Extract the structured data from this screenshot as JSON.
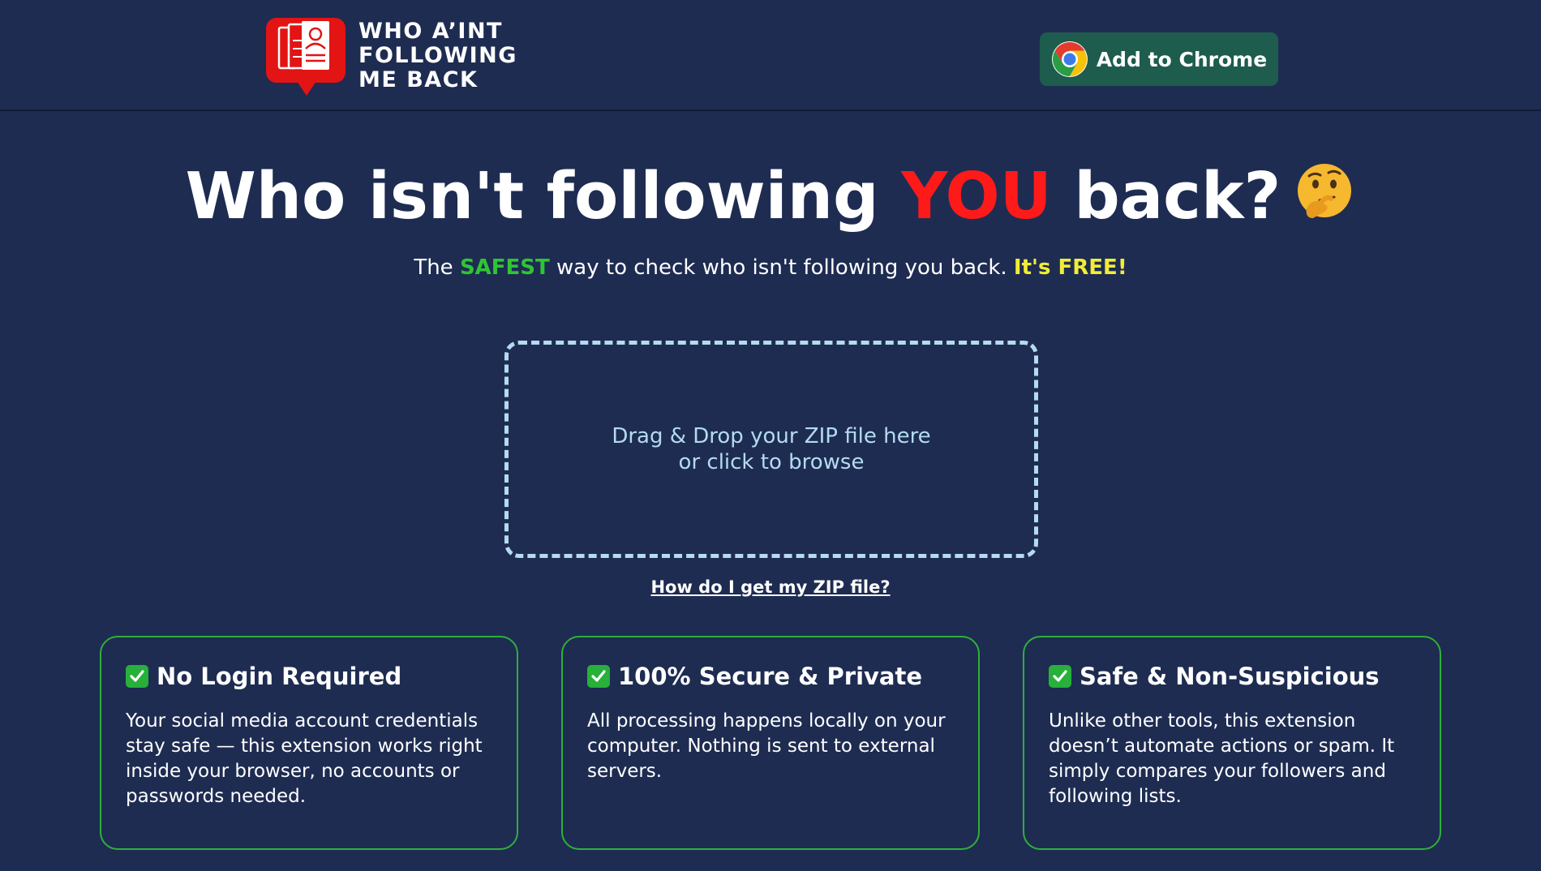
{
  "header": {
    "logo_lines": [
      "WHO A’INT",
      "FOLLOWING",
      "ME BACK"
    ],
    "cta_label": "Add to Chrome"
  },
  "hero": {
    "title_before": "Who isn't following ",
    "title_accent": "YOU",
    "title_after": " back?",
    "subtitle_prefix": "The ",
    "subtitle_safe": "SAFEST",
    "subtitle_middle": " way to check who isn't following you back. ",
    "subtitle_free": "It's FREE!"
  },
  "dropzone": {
    "line1": "Drag & Drop your ZIP file here",
    "line2": "or click to browse"
  },
  "help_link": "How do I get my ZIP file?",
  "features": [
    {
      "title": "No Login Required",
      "body": "Your social media account credentials stay safe — this extension works right inside your browser, no accounts or passwords needed."
    },
    {
      "title": "100% Secure & Private",
      "body": "All processing happens locally on your computer. Nothing is sent to external servers."
    },
    {
      "title": "Safe & Non-Suspicious",
      "body": "Unlike other tools, this extension doesn’t automate actions or spam. It simply compares your followers and following lists."
    }
  ],
  "colors": {
    "background": "#1e2c52",
    "accent_red": "#ff1a1a",
    "safe_green": "#2ec533",
    "free_yellow": "#f2ec36",
    "button_green": "#1e5c4d",
    "card_border": "#2faf3a",
    "dropzone_border": "#b4dbef"
  },
  "icons": {
    "logo": "profile-pages-icon",
    "chrome": "chrome-icon",
    "hero": "thinking-face-icon",
    "feature": "check-mark-icon"
  }
}
